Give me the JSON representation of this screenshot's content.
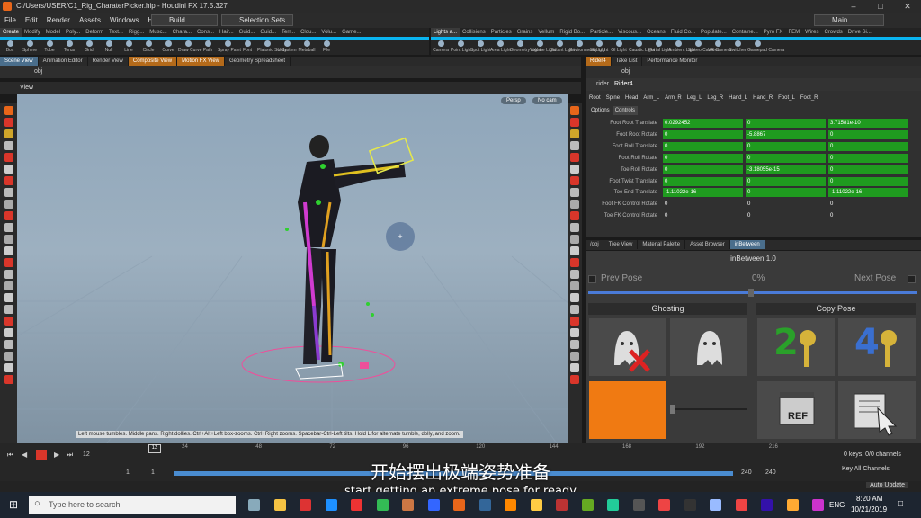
{
  "window": {
    "title": "C:/Users/USER/C1_Rig_CharaterPicker.hip - Houdini FX 17.5.327"
  },
  "menu": {
    "items": [
      "File",
      "Edit",
      "Render",
      "Assets",
      "Windows",
      "Help"
    ],
    "desktop": "Build",
    "selection_sets": "Selection Sets",
    "workspace": "Main"
  },
  "shelf_left": {
    "tabs": [
      "Create",
      "Modify",
      "Model",
      "Poly...",
      "Deform",
      "Text...",
      "Rigg...",
      "Musc...",
      "Chara...",
      "Cons...",
      "Hair...",
      "Guid...",
      "Guid...",
      "Terr...",
      "Clou...",
      "Volu...",
      "Game..."
    ],
    "tools": [
      "Box",
      "Sphere",
      "Tube",
      "Torus",
      "Grid",
      "Null",
      "Line",
      "Circle",
      "Curve",
      "Draw Curve",
      "Path",
      "Spray Paint",
      "Font",
      "Platonic Solids",
      "L-System",
      "Metaball",
      "File"
    ]
  },
  "shelf_right": {
    "tabs": [
      "Lights a...",
      "Collisions",
      "Particles",
      "Grains",
      "Vellum",
      "Rigid Bo...",
      "Particle...",
      "Viscous...",
      "Oceans",
      "Fluid Co...",
      "Populate...",
      "Containe...",
      "Pyro FX",
      "FEM",
      "Wires",
      "Crowds",
      "Drive Si..."
    ],
    "tools": [
      "Camera",
      "Point Light",
      "Spot Light",
      "Area Light",
      "Geometry Light",
      "Volume Light",
      "Distant Light",
      "Environment Light",
      "Sky Light",
      "GI Light",
      "Caustic Light",
      "Portal Light",
      "Ambient Light",
      "Stereo Camera",
      "VR Camera",
      "Switcher",
      "Gamepad Camera"
    ]
  },
  "left_tabs": [
    "Scene View",
    "Animation Editor",
    "Render View",
    "Composite View",
    "Motion FX View",
    "Geometry Spreadsheet"
  ],
  "right_tabs": [
    "Rider4",
    "Take List",
    "Performance Monitor"
  ],
  "path": "obj",
  "viewport": {
    "label": "View",
    "persp": "Persp",
    "cam": "No cam",
    "hint": "Left mouse tumbles. Middle pans. Right dollies. Ctrl+Alt+Left box-zooms. Ctrl+Right zooms. Spacebar-Ctrl-Left tilts. Hold L for alternate tumble, dolly, and zoom."
  },
  "params": {
    "type": "rider",
    "name": "Rider4",
    "tabs": [
      "Root",
      "Spine",
      "Head",
      "Arm_L",
      "Arm_R",
      "Leg_L",
      "Leg_R",
      "Hand_L",
      "Hand_R",
      "Foot_L",
      "Foot_R"
    ],
    "subtabs": [
      "Options",
      "Controls"
    ],
    "rows": [
      {
        "label": "Foot Root Translate",
        "v": [
          "0.0292452",
          "0",
          "3.71581e-10"
        ],
        "green": true
      },
      {
        "label": "Foot Root Rotate",
        "v": [
          "0",
          "-5.8867",
          "0"
        ],
        "green": true
      },
      {
        "label": "Foot Roll Translate",
        "v": [
          "0",
          "0",
          "0"
        ],
        "green": true
      },
      {
        "label": "Foot Roll Rotate",
        "v": [
          "0",
          "0",
          "0"
        ],
        "green": true
      },
      {
        "label": "Toe Roll Rotate",
        "v": [
          "0",
          "-3.18055e-15",
          "0"
        ],
        "green": true
      },
      {
        "label": "Foot Twist Translate",
        "v": [
          "0",
          "0",
          "0"
        ],
        "green": true
      },
      {
        "label": "Toe End Translate",
        "v": [
          "-1.11022e-16",
          "0",
          "-1.11022e-16"
        ],
        "green": true
      },
      {
        "label": "Foot FK Control Rotate",
        "v": [
          "0",
          "0",
          "0"
        ],
        "green": false
      },
      {
        "label": "Toe FK Control Rotate",
        "v": [
          "0",
          "0",
          "0"
        ],
        "green": false
      }
    ]
  },
  "lower_tabs": [
    "/obj",
    "Tree View",
    "Material Palette",
    "Asset Browser",
    "inBetween"
  ],
  "inbetween": {
    "title": "inBetween 1.0",
    "prev": "Prev Pose",
    "pct": "0%",
    "next": "Next Pose",
    "ghosting": "Ghosting",
    "copy_pose": "Copy Pose",
    "ref": "REF",
    "ghost_off_icon": "ghost-x-icon",
    "ghost_on_icon": "ghost-icon",
    "key2": "2",
    "key4": "4",
    "swatch_color": "#f07a12"
  },
  "timeline": {
    "frame": "12",
    "ticks": [
      "12",
      "24",
      "48",
      "72",
      "96",
      "120",
      "144",
      "168",
      "192",
      "216"
    ],
    "start": "1",
    "start2": "1",
    "end": "240",
    "end2": "240",
    "keys": "0 keys, 0/0 channels",
    "key_all": "Key All Channels",
    "auto_update": "Auto Update"
  },
  "subtitle": {
    "cn": "开始摆出极端姿势准备",
    "en": "start getting an extreme pose for ready"
  },
  "taskbar": {
    "search": "Type here to search",
    "time": "8:20 AM",
    "date": "10/21/2019",
    "lang": "ENG"
  }
}
